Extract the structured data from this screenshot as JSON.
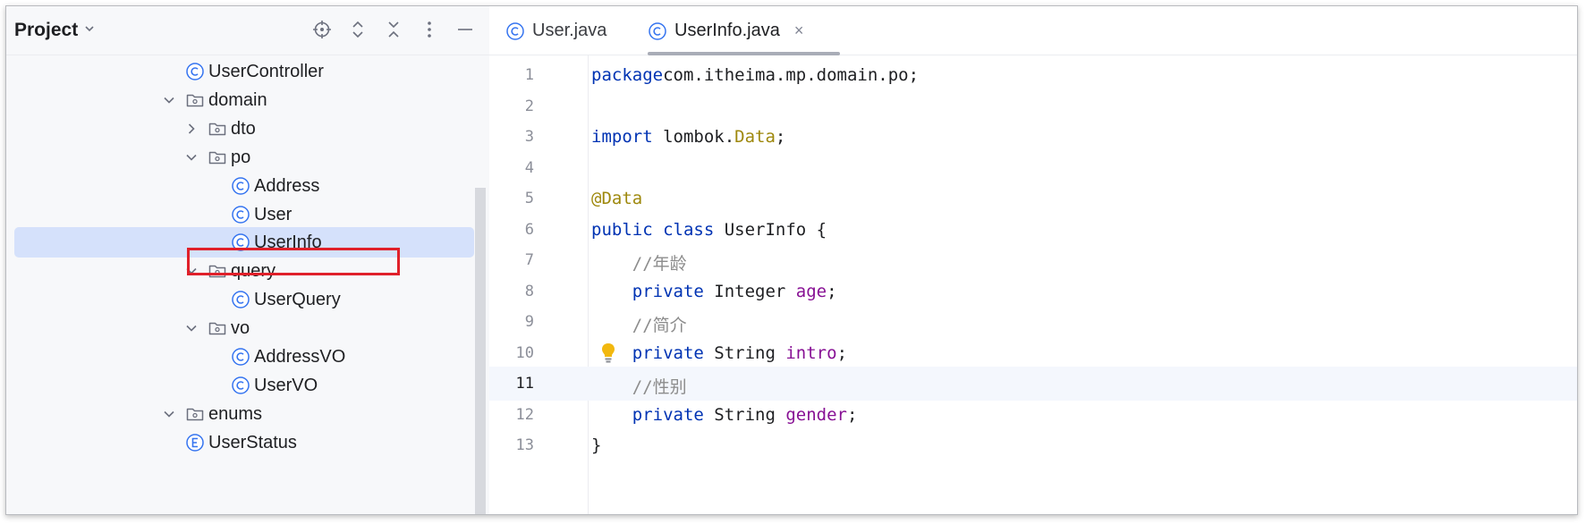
{
  "project": {
    "title": "Project",
    "tree": [
      {
        "label": "UserController",
        "icon": "class-icon"
      },
      {
        "label": "domain",
        "icon": "package-icon",
        "expanded": true
      },
      {
        "label": "dto",
        "icon": "package-icon",
        "expanded": false
      },
      {
        "label": "po",
        "icon": "package-icon",
        "expanded": true
      },
      {
        "label": "Address",
        "icon": "class-icon"
      },
      {
        "label": "User",
        "icon": "class-icon"
      },
      {
        "label": "UserInfo",
        "icon": "class-icon",
        "selected": true
      },
      {
        "label": "query",
        "icon": "package-icon",
        "expanded": true
      },
      {
        "label": "UserQuery",
        "icon": "class-icon"
      },
      {
        "label": "vo",
        "icon": "package-icon",
        "expanded": true
      },
      {
        "label": "AddressVO",
        "icon": "class-icon"
      },
      {
        "label": "UserVO",
        "icon": "class-icon"
      },
      {
        "label": "enums",
        "icon": "package-icon",
        "expanded": true
      },
      {
        "label": "UserStatus",
        "icon": "enum-icon"
      }
    ]
  },
  "editor": {
    "tabs": [
      {
        "label": "User.java",
        "active": false
      },
      {
        "label": "UserInfo.java",
        "active": true,
        "close": "×"
      }
    ],
    "current_line": 11,
    "lines": [
      {
        "num": "1",
        "tokens": [
          [
            "kw",
            "package"
          ],
          [
            "",
            "com.itheima.mp.domain.po;"
          ]
        ]
      },
      {
        "num": "2",
        "tokens": []
      },
      {
        "num": "3",
        "tokens": [
          [
            "kw",
            "import"
          ],
          [
            "",
            " lombok."
          ],
          [
            "ann",
            "Data"
          ],
          [
            "",
            ";"
          ]
        ]
      },
      {
        "num": "4",
        "tokens": []
      },
      {
        "num": "5",
        "tokens": [
          [
            "ann",
            "@Data"
          ]
        ]
      },
      {
        "num": "6",
        "tokens": [
          [
            "kw",
            "public class"
          ],
          [
            "",
            " UserInfo {"
          ]
        ]
      },
      {
        "num": "7",
        "tokens": [
          [
            "",
            "    "
          ],
          [
            "cmt",
            "//年龄"
          ]
        ]
      },
      {
        "num": "8",
        "tokens": [
          [
            "",
            "    "
          ],
          [
            "kw",
            "private"
          ],
          [
            "",
            " Integer "
          ],
          [
            "fld",
            "age"
          ],
          [
            "",
            ";"
          ]
        ]
      },
      {
        "num": "9",
        "tokens": [
          [
            "",
            "    "
          ],
          [
            "cmt",
            "//简介"
          ]
        ]
      },
      {
        "num": "10",
        "tokens": [
          [
            "",
            "    "
          ],
          [
            "kw",
            "private"
          ],
          [
            "",
            " String "
          ],
          [
            "fld",
            "intro"
          ],
          [
            "",
            ";"
          ]
        ]
      },
      {
        "num": "11",
        "tokens": [
          [
            "",
            "    "
          ],
          [
            "cmt",
            "//性别"
          ]
        ]
      },
      {
        "num": "12",
        "tokens": [
          [
            "",
            "    "
          ],
          [
            "kw",
            "private"
          ],
          [
            "",
            " String "
          ],
          [
            "fld",
            "gender"
          ],
          [
            "",
            ";"
          ]
        ]
      },
      {
        "num": "13",
        "tokens": [
          [
            "",
            "}"
          ]
        ]
      }
    ]
  },
  "colors": {
    "keyword": "#0033b3",
    "annotation": "#9e880d",
    "field": "#871094",
    "comment": "#8c8c8c",
    "selection": "#d5e1fb",
    "highlight_box": "#e0202a"
  }
}
